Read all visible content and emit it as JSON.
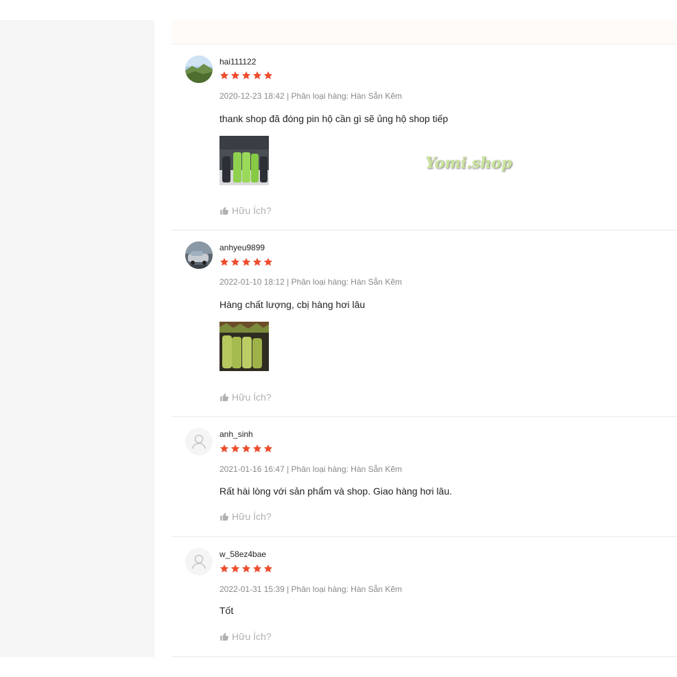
{
  "colors": {
    "star": "#ee4d2d",
    "meta_text": "#888888",
    "helpful_text": "#b0b0b0"
  },
  "reviews": [
    {
      "username": "hai111122",
      "rating": 5,
      "date": "2020-12-23 18:42",
      "variation": "| Phân loại hàng: Hàn Sẵn Kẽm",
      "comment": "thank shop đã đóng pin hộ cần gì sẽ ủng hộ shop tiếp",
      "has_photo": true,
      "watermark": "Yomi.shop",
      "helpful_label": "Hữu Ích?",
      "avatar": "landscape-photo"
    },
    {
      "username": "anhyeu9899",
      "rating": 5,
      "date": "2022-01-10 18:12",
      "variation": "| Phân loại hàng: Hàn Sẵn Kẽm",
      "comment": "Hàng chất lượng, cbị hàng hơi lâu",
      "has_photo": true,
      "helpful_label": "Hữu Ích?",
      "avatar": "car-photo"
    },
    {
      "username": "anh_sinh",
      "rating": 5,
      "date": "2021-01-16 16:47",
      "variation": "| Phân loại hàng: Hàn Sẵn Kẽm",
      "comment": "Rất hài lòng với sản phẩm và shop. Giao hàng hơi lâu.",
      "has_photo": false,
      "helpful_label": "Hữu Ích?",
      "avatar": "default-user"
    },
    {
      "username": "w_58ez4bae",
      "rating": 5,
      "date": "2022-01-31 15:39",
      "variation": "| Phân loại hàng: Hàn Sẵn Kẽm",
      "comment": "Tốt",
      "has_photo": false,
      "helpful_label": "Hữu Ích?",
      "avatar": "default-user"
    }
  ]
}
